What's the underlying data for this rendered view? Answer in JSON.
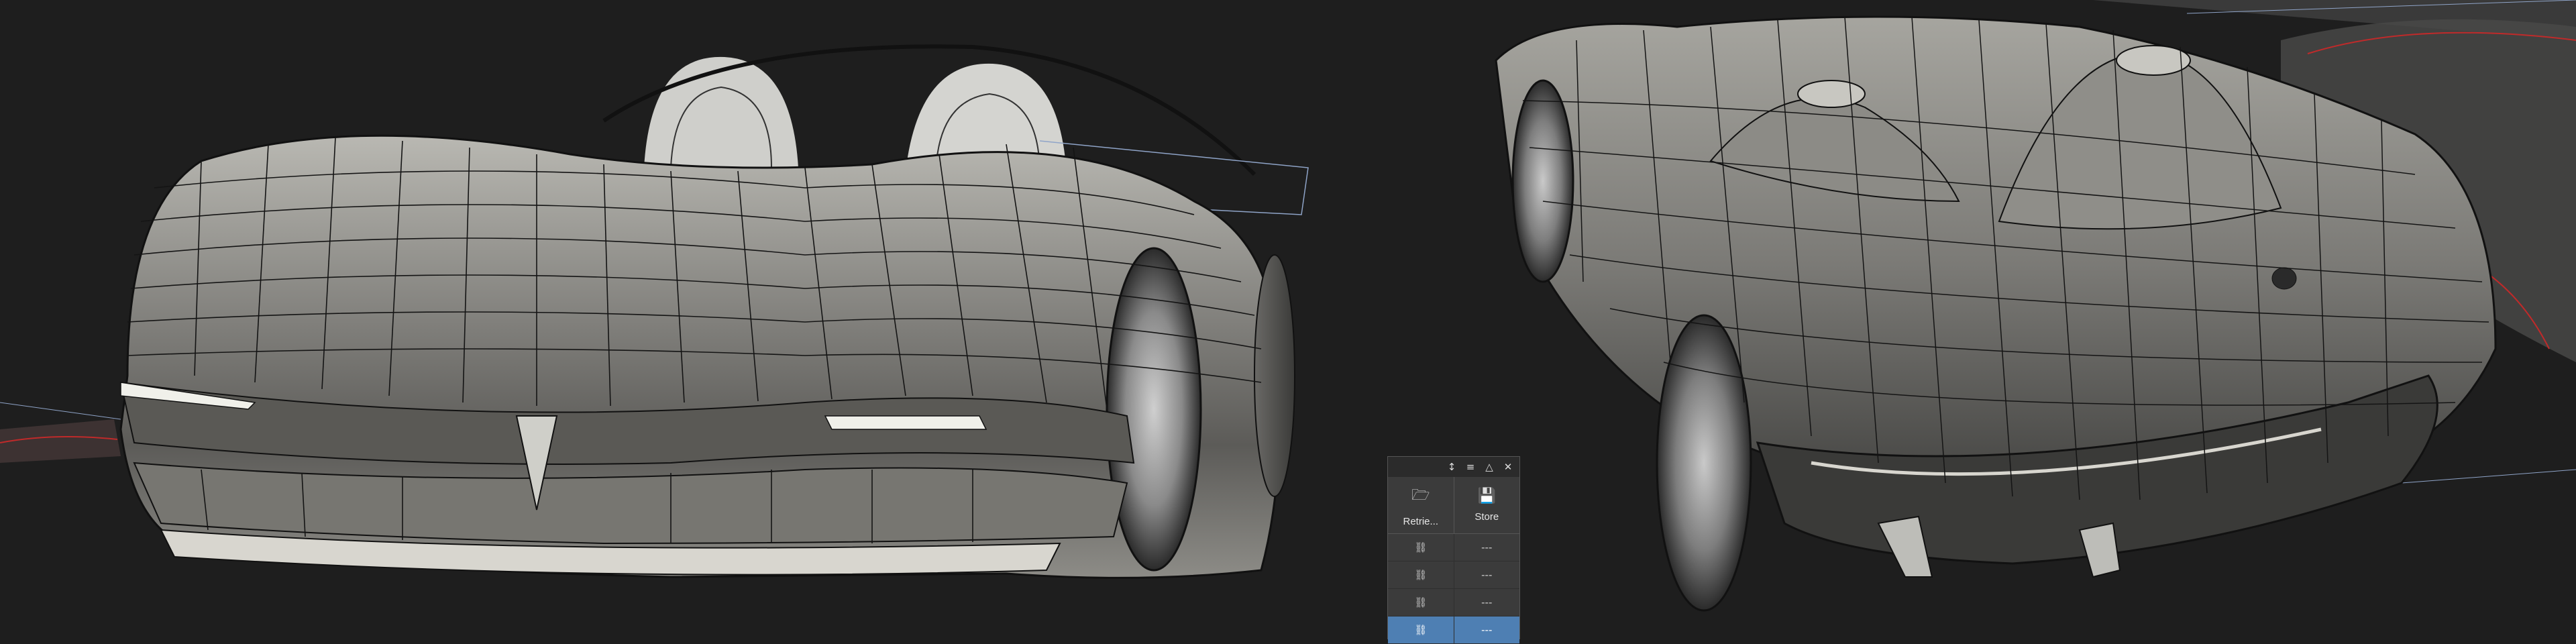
{
  "panel": {
    "title_icons": [
      "pin-icon",
      "menu-icon",
      "triangle-icon",
      "close-icon"
    ],
    "title_glyphs": {
      "pin": "↕",
      "menu": "≡",
      "triangle": "△",
      "close": "✕"
    },
    "tools": [
      {
        "label": "Retrie...",
        "icon": "folder-open-icon",
        "glyph": "🗁"
      },
      {
        "label": "Store",
        "icon": "save-icon",
        "glyph": "💾"
      }
    ],
    "rows": [
      {
        "link": "⛓",
        "value": "---",
        "selected": false
      },
      {
        "link": "⛓",
        "value": "---",
        "selected": false
      },
      {
        "link": "⛓",
        "value": "---",
        "selected": false
      },
      {
        "link": "⛓",
        "value": "---",
        "selected": true
      }
    ]
  },
  "colors": {
    "background": "#1e1e1e",
    "surface": "#8a8a86",
    "wire": "#141414",
    "guide": "#8fa4c8",
    "accent_red": "#c02a2a",
    "selection": "#4e7fb3"
  }
}
